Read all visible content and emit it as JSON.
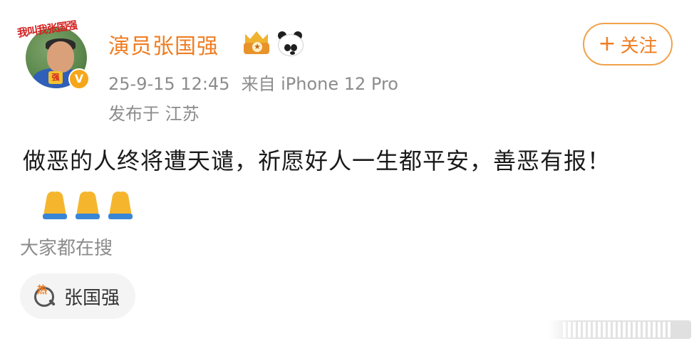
{
  "post": {
    "author": {
      "name": "演员张国强",
      "avatar_stamp_text": "我叫我张国强",
      "avatar_emblem": "强",
      "verified_badge": "V",
      "badges": [
        "crown-badge-icon",
        "panda-icon"
      ]
    },
    "follow_button": {
      "plus": "+",
      "label": "关注"
    },
    "timestamp": "25-9-15 12:45",
    "source": "来自 iPhone 12 Pro",
    "location": "发布于 江苏",
    "text": "做恶的人终将遭天谴，祈愿好人一生都平安，善恶有报！",
    "emoji": [
      "🙏",
      "🙏",
      "🙏"
    ]
  },
  "everyone_searching": {
    "heading": "大家都在搜",
    "hot_icon_text": "热",
    "items": [
      {
        "label": "张国强"
      }
    ]
  },
  "colors": {
    "accent_orange": "#ef7d22",
    "meta_gray": "#8c8c8c",
    "text_dark": "#1a1a1a",
    "chip_bg": "#f4f4f4"
  }
}
